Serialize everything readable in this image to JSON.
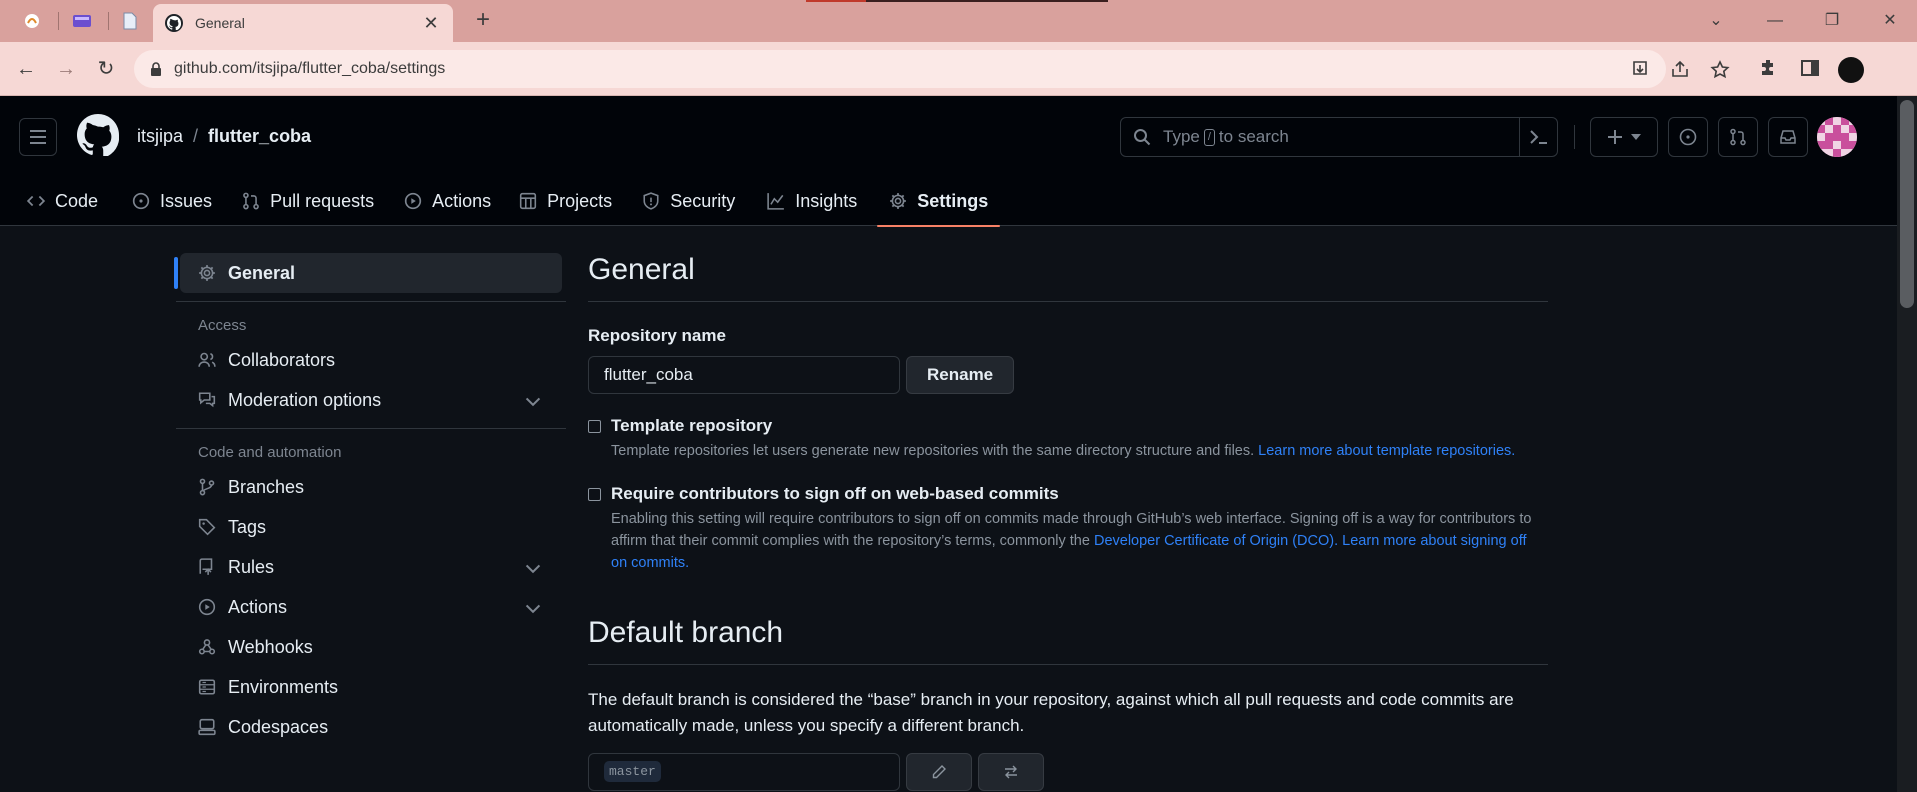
{
  "browser": {
    "tab_title": "General",
    "url": "github.com/itsjipa/flutter_coba/settings"
  },
  "header": {
    "owner": "itsjipa",
    "separator": "/",
    "repo": "flutter_coba",
    "search_placeholder_pre": "Type",
    "search_key": "/",
    "search_placeholder_post": "to search"
  },
  "repo_nav": [
    {
      "label": "Code",
      "icon": "code-icon"
    },
    {
      "label": "Issues",
      "icon": "issues-icon"
    },
    {
      "label": "Pull requests",
      "icon": "pull-request-icon"
    },
    {
      "label": "Actions",
      "icon": "actions-icon"
    },
    {
      "label": "Projects",
      "icon": "projects-icon"
    },
    {
      "label": "Security",
      "icon": "shield-icon"
    },
    {
      "label": "Insights",
      "icon": "graph-icon"
    },
    {
      "label": "Settings",
      "icon": "gear-icon",
      "selected": true
    }
  ],
  "sidebar": {
    "general": "General",
    "access_heading": "Access",
    "collaborators": "Collaborators",
    "moderation": "Moderation options",
    "code_heading": "Code and automation",
    "branches": "Branches",
    "tags": "Tags",
    "rules": "Rules",
    "actions": "Actions",
    "webhooks": "Webhooks",
    "environments": "Environments",
    "codespaces": "Codespaces"
  },
  "main": {
    "title": "General",
    "repo_name_label": "Repository name",
    "repo_name_value": "flutter_coba",
    "rename_button": "Rename",
    "template_title": "Template repository",
    "template_desc": "Template repositories let users generate new repositories with the same directory structure and files.",
    "template_link": "Learn more about template repositories.",
    "signoff_title": "Require contributors to sign off on web-based commits",
    "signoff_desc": "Enabling this setting will require contributors to sign off on commits made through GitHub’s web interface. Signing off is a way for contributors to affirm that their commit complies with the repository’s terms, commonly the",
    "signoff_link1": "Developer Certificate of Origin (DCO).",
    "signoff_link2": "Learn more about signing off on commits.",
    "default_branch_title": "Default branch",
    "default_branch_desc": "The default branch is considered the “base” branch in your repository, against which all pull requests and code commits are automatically made, unless you specify a different branch.",
    "branch_value": "master"
  },
  "colors": {
    "accent": "#2f81f7",
    "tab_underline": "#f78166",
    "bg": "#0d1117",
    "header_bg": "#010409"
  }
}
